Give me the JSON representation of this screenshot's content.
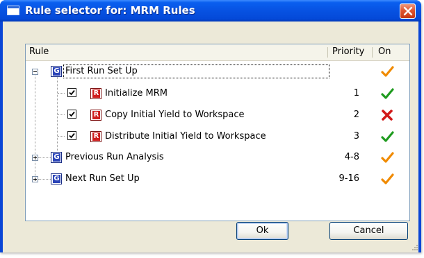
{
  "window": {
    "title": "Rule selector for: MRM Rules",
    "title_icon": "window-icon",
    "close_icon": "close-icon"
  },
  "list": {
    "columns": [
      "Rule",
      "Priority",
      "On"
    ],
    "rows": [
      {
        "level": 0,
        "expander": "minus",
        "icon": "group-icon",
        "icon_letter": "G",
        "label": "First Run Set Up",
        "priority": "",
        "on": "partial",
        "selected": true
      },
      {
        "level": 1,
        "checked": true,
        "icon": "rule-icon",
        "icon_letter": "R",
        "label": "Initialize MRM",
        "priority": "1",
        "on": "on"
      },
      {
        "level": 1,
        "checked": true,
        "icon": "rule-icon",
        "icon_letter": "R",
        "label": "Copy Initial Yield to Workspace",
        "priority": "2",
        "on": "off"
      },
      {
        "level": 1,
        "checked": true,
        "icon": "rule-icon",
        "icon_letter": "R",
        "label": "Distribute Initial Yield to Workspace",
        "priority": "3",
        "on": "on"
      },
      {
        "level": 0,
        "expander": "plus",
        "icon": "group-icon",
        "icon_letter": "G",
        "label": "Previous Run Analysis",
        "priority": "4-8",
        "on": "partial"
      },
      {
        "level": 0,
        "expander": "plus",
        "icon": "group-icon",
        "icon_letter": "G",
        "label": "Next Run Set Up",
        "priority": "9-16",
        "on": "partial"
      }
    ]
  },
  "buttons": {
    "ok": "Ok",
    "cancel": "Cancel"
  },
  "colors": {
    "check_on": "#1f9b1f",
    "check_partial": "#f08a00",
    "cross_off": "#d11a1a",
    "titlebar": "#0752e2"
  }
}
